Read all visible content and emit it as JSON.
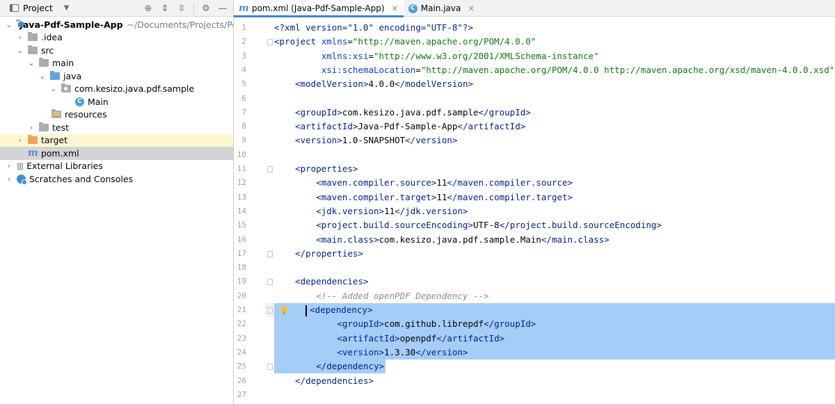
{
  "project_panel": {
    "title": "Project",
    "tree": [
      {
        "label": "Java-Pdf-Sample-App",
        "path": "~/Documents/Projects/Perso"
      },
      {
        "label": ".idea"
      },
      {
        "label": "src"
      },
      {
        "label": "main"
      },
      {
        "label": "java"
      },
      {
        "label": "com.kesizo.java.pdf.sample"
      },
      {
        "label": "Main"
      },
      {
        "label": "resources"
      },
      {
        "label": "test"
      },
      {
        "label": "target"
      },
      {
        "label": "pom.xml"
      },
      {
        "label": "External Libraries"
      },
      {
        "label": "Scratches and Consoles"
      }
    ]
  },
  "tabs": [
    {
      "label": "pom.xml (Java-Pdf-Sample-App)",
      "active": true,
      "close": "✕"
    },
    {
      "label": "Main.java",
      "active": false,
      "close": "✕"
    }
  ],
  "editor": {
    "line_numbers": [
      "1",
      "2",
      "3",
      "4",
      "5",
      "6",
      "7",
      "8",
      "9",
      "10",
      "11",
      "12",
      "13",
      "14",
      "15",
      "16",
      "17",
      "18",
      "19",
      "20",
      "21",
      "22",
      "23",
      "24",
      "25",
      "26",
      "27"
    ],
    "lines": [
      [
        "pi:<?xml version=\"1.0\" encoding=\"UTF-8\"?>"
      ],
      [
        "tag:<project ",
        "an:xmlns",
        "t:=",
        "av:\"http://maven.apache.org/POM/4.0.0\""
      ],
      [
        "t:         ",
        "an:xmlns:xsi",
        "t:=",
        "av:\"http://www.w3.org/2001/XMLSchema-instance\""
      ],
      [
        "t:         ",
        "an:xsi:schemaLocation",
        "t:=",
        "av:\"http://maven.apache.org/POM/4.0.0 http://maven.apache.org/xsd/maven-4.0.0.xsd\"",
        "tag:>"
      ],
      [
        "t:    ",
        "tag:<modelVersion>",
        "t:4.0.0",
        "tag:</modelVersion>"
      ],
      [
        "t:"
      ],
      [
        "t:    ",
        "tag:<groupId>",
        "t:com.kesizo.java.pdf.sample",
        "tag:</groupId>"
      ],
      [
        "t:    ",
        "tag:<artifactId>",
        "t:Java-Pdf-Sample-App",
        "tag:</artifactId>"
      ],
      [
        "t:    ",
        "tag:<version>",
        "t:1.0-SNAPSHOT",
        "tag:</version>"
      ],
      [
        "t:"
      ],
      [
        "t:    ",
        "tag:<properties>"
      ],
      [
        "t:        ",
        "tag:<maven.compiler.source>",
        "t:11",
        "tag:</maven.compiler.source>"
      ],
      [
        "t:        ",
        "tag:<maven.compiler.target>",
        "t:11",
        "tag:</maven.compiler.target>"
      ],
      [
        "t:        ",
        "tag:<jdk.version>",
        "t:11",
        "tag:</jdk.version>"
      ],
      [
        "t:        ",
        "tag:<project.build.sourceEncoding>",
        "t:UTF-8",
        "tag:</project.build.sourceEncoding>"
      ],
      [
        "t:        ",
        "tag:<main.class>",
        "t:com.kesizo.java.pdf.sample.Main",
        "tag:</main.class>"
      ],
      [
        "t:    ",
        "tag:</properties>"
      ],
      [
        "t:"
      ],
      [
        "t:    ",
        "tag:<dependencies>"
      ],
      [
        "t:        ",
        "cm:<!-- Added openPDF Dependency -->"
      ],
      [
        "t:      ",
        "caret:",
        "tag:<dependency>"
      ],
      [
        "t:            ",
        "tag:<groupId>",
        "t:com.github.librepdf",
        "tag:</groupId>"
      ],
      [
        "t:            ",
        "tag:<artifactId>",
        "t:openpdf",
        "tag:</artifactId>"
      ],
      [
        "t:            ",
        "tag:<version>",
        "t:1.3.30",
        "tag:</version>"
      ],
      [
        "t:        ",
        "tag:</dependency>"
      ],
      [
        "t:    ",
        "tag:</dependencies>"
      ],
      [
        "t:"
      ]
    ],
    "highlighted_lines_full": [
      21,
      22,
      23,
      24
    ],
    "highlighted_line_partial": 25,
    "fold_marker_lines": [
      2,
      11,
      17,
      19,
      21,
      25
    ]
  },
  "colors": {
    "selection": "#a5cdf7",
    "tag": "#00208a",
    "attr_name": "#0a3ecf",
    "attr_value": "#0b7a0b",
    "comment": "#8c8c8c"
  }
}
